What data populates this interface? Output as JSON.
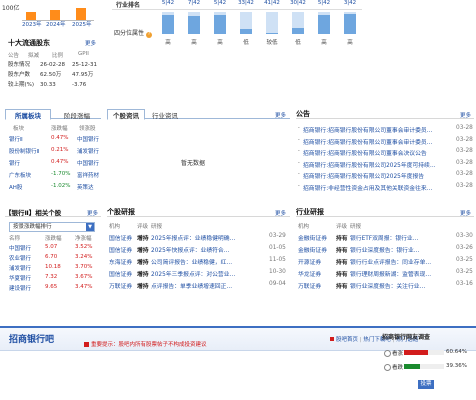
{
  "topleft": {
    "cap_label": "100亿",
    "years": [
      "2023年",
      "2024年",
      "2025年"
    ],
    "bar_values_pct": [
      60,
      74,
      86
    ]
  },
  "holders": {
    "title": "十大流通股东",
    "more": "更多",
    "headers": [
      "公告",
      "拟减",
      "比例",
      "GPII"
    ],
    "rows": [
      {
        "label": "股东情况",
        "v1": "26-02-28",
        "v2": "25-12-31"
      },
      {
        "label": "股东户数",
        "v1": "62.50万",
        "v2": "47.95万"
      },
      {
        "label": "较上期(%)",
        "v1": "30.33",
        "v2": "-3.76"
      }
    ]
  },
  "industry_rank": {
    "label": "行业排名",
    "values": [
      "5|42",
      "7|42",
      "5|42",
      "33|42",
      "41|42",
      "30|42",
      "5|42",
      "3|42"
    ],
    "quartile_label": "四分位属性",
    "quartile_help": "?",
    "levels_pct": [
      85,
      82,
      86,
      22,
      6,
      28,
      86,
      92
    ],
    "quartiles": [
      "高",
      "高",
      "高",
      "低",
      "较低",
      "低",
      "高",
      "高"
    ]
  },
  "sector": {
    "tab_active": "所属板块",
    "tab_2": "阶段涨幅",
    "headers": [
      "板块",
      "涨跌幅",
      "领涨股"
    ],
    "rows": [
      {
        "name": "银行Ⅱ",
        "change": "0.47%",
        "leader": "中国银行",
        "dir": "up"
      },
      {
        "name": "股份制银行Ⅱ",
        "change": "0.21%",
        "leader": "浦发银行",
        "dir": "up"
      },
      {
        "name": "银行",
        "change": "0.47%",
        "leader": "中国银行",
        "dir": "up"
      },
      {
        "name": "广东板块",
        "change": "-1.70%",
        "leader": "富祥药材",
        "dir": "down"
      },
      {
        "name": "AH股",
        "change": "-1.02%",
        "leader": "英策达",
        "dir": "down"
      }
    ]
  },
  "news": {
    "tab_active": "个股资讯",
    "tab_2": "行业资讯",
    "more": "更多",
    "empty": "暂无数据"
  },
  "announcements": {
    "title": "公告",
    "more": "更多",
    "items": [
      {
        "text": "招商银行:招商银行股份有限公司董事会审计委员…",
        "date": "03-28"
      },
      {
        "text": "招商银行:招商银行股份有限公司董事会审计委员…",
        "date": "03-28"
      },
      {
        "text": "招商银行:招商银行股份有限公司董事会决议公告",
        "date": "03-28"
      },
      {
        "text": "招商银行:招商银行股份有限公司2025年度可持续…",
        "date": "03-28"
      },
      {
        "text": "招商银行:招商银行股份有限公司2025年度报告",
        "date": "03-28"
      },
      {
        "text": "招商银行:非经营性资金占用及其他关联资金往来…",
        "date": "03-28"
      }
    ]
  },
  "related": {
    "title": "【银行Ⅱ】相关个股",
    "more": "更多",
    "select": "按景涨跌幅排行",
    "headers": [
      "名称",
      "涨跌幅",
      "净涨幅"
    ],
    "rows": [
      {
        "name": "中国银行",
        "v1": "5.07",
        "v2": "3.52%"
      },
      {
        "name": "农业银行",
        "v1": "6.70",
        "v2": "3.24%"
      },
      {
        "name": "浦发银行",
        "v1": "10.18",
        "v2": "3.70%"
      },
      {
        "name": "华夏银行",
        "v1": "7.32",
        "v2": "3.67%"
      },
      {
        "name": "建设银行",
        "v1": "9.65",
        "v2": "3.47%"
      }
    ]
  },
  "stock_research": {
    "title": "个股研报",
    "more": "更多",
    "headers": [
      "机构",
      "评级",
      "研报"
    ],
    "rows": [
      {
        "org": "国信证券",
        "rating": "增持",
        "text": "2025年报点评：业绩稳健明确…",
        "date": "03-29"
      },
      {
        "org": "国信证券",
        "rating": "增持",
        "text": "2025年快报点评：业绩符合…",
        "date": "01-05"
      },
      {
        "org": "东海证券",
        "rating": "增持",
        "text": "公司简评报告：业绩稳健，红…",
        "date": "11-05"
      },
      {
        "org": "国信证券",
        "rating": "增持",
        "text": "2025年三季报点评：对公营业…",
        "date": "10-30"
      },
      {
        "org": "万联证券",
        "rating": "增持",
        "text": "点评报告：单季业绩增速回正…",
        "date": "09-04"
      }
    ]
  },
  "industry_research": {
    "title": "行业研报",
    "more": "更多",
    "headers": [
      "机构",
      "评级",
      "研报"
    ],
    "rows": [
      {
        "org": "金融街证券",
        "rating": "持有",
        "text": "银行ETF双周报：银行业…",
        "date": "03-30"
      },
      {
        "org": "金融街证券",
        "rating": "持有",
        "text": "银行业深度报告：银行业…",
        "date": "03-26"
      },
      {
        "org": "开源证券",
        "rating": "持有",
        "text": "银行行业点评报告：同业存单…",
        "date": "03-25"
      },
      {
        "org": "华龙证券",
        "rating": "持有",
        "text": "银行理财周报新湖：监管表现…",
        "date": "03-25"
      },
      {
        "org": "万联证券",
        "rating": "持有",
        "text": "银行业深度报告：关注行业…",
        "date": "03-16"
      }
    ]
  },
  "forum": {
    "title": "招商银行吧",
    "notice": "重要提示：股吧内所有股票帖子不构成投资建议",
    "links": [
      "股吧首页",
      "热门下载吧",
      "热门话题"
    ],
    "survey_title": "招商银行网友调查",
    "options": [
      {
        "label": "看涨",
        "pct": "60.64%",
        "fill_pct": 61,
        "color": "#d21c1c"
      },
      {
        "label": "看跌",
        "pct": "39.36%",
        "fill_pct": 39,
        "color": "#1a8a2e"
      }
    ],
    "vote": "投票"
  }
}
